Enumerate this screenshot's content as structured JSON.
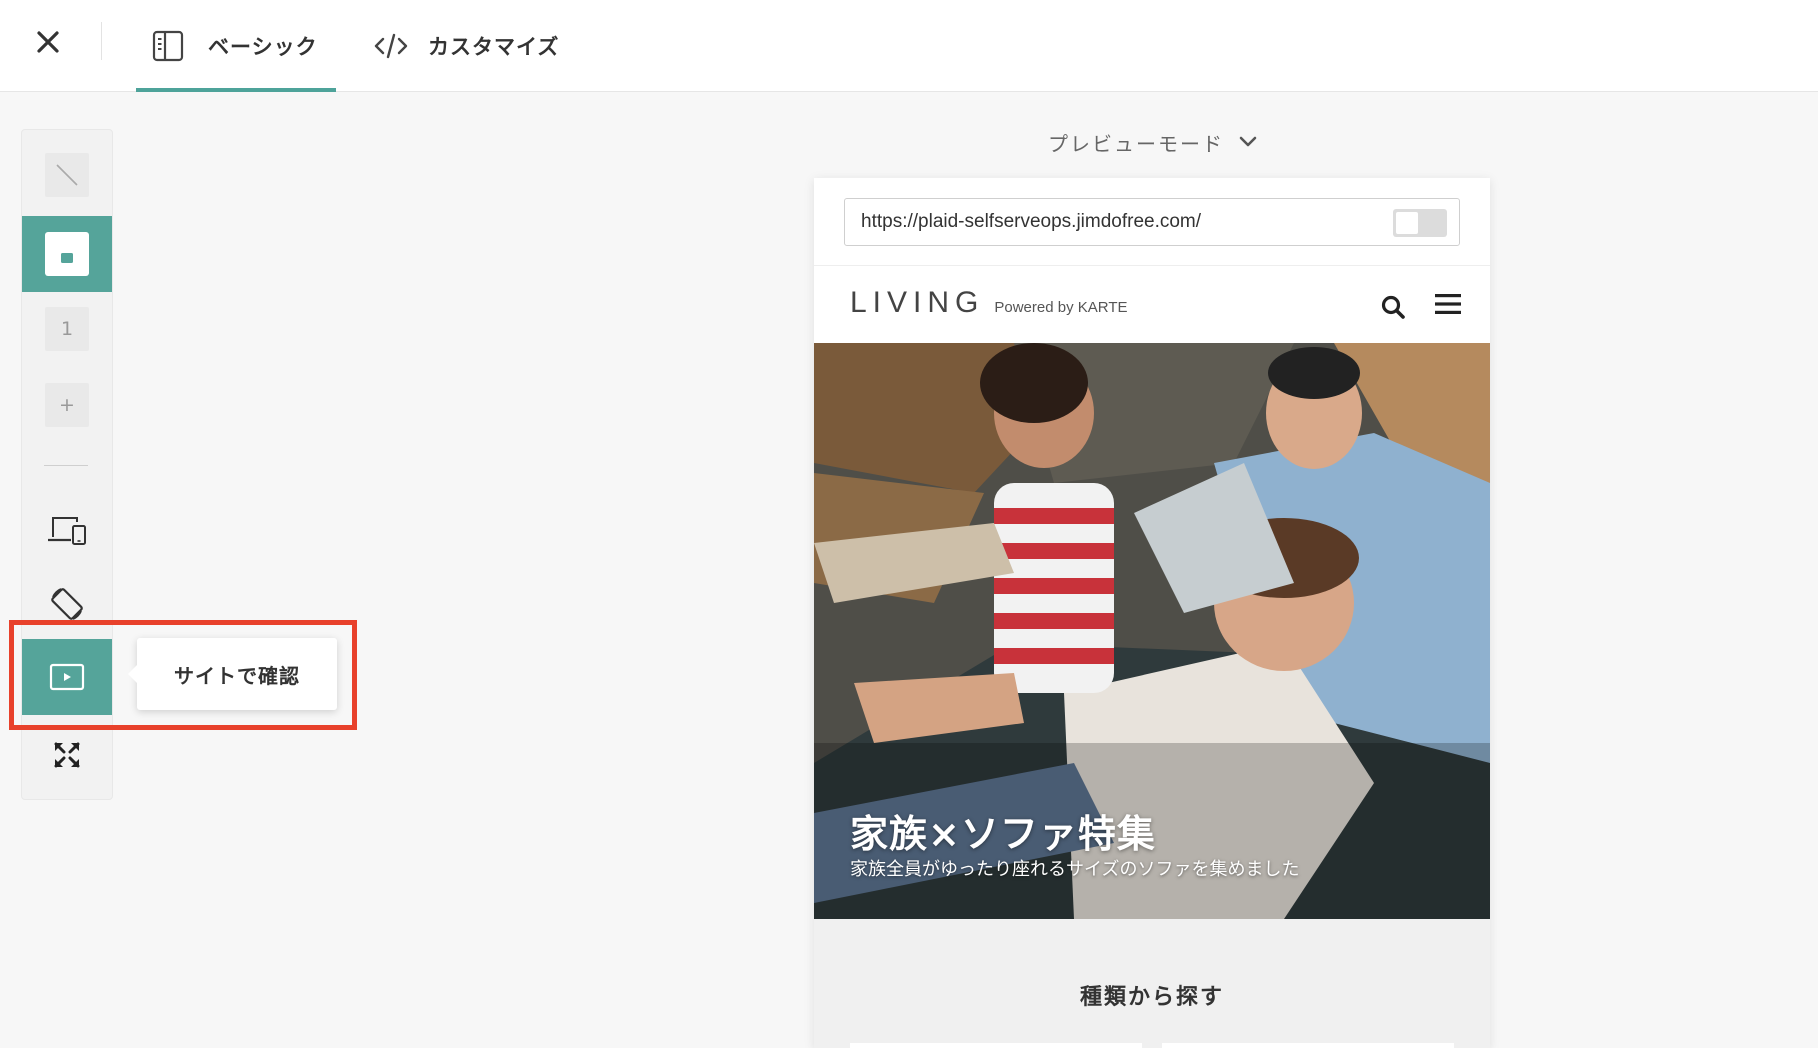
{
  "topbar": {
    "close_icon": "close-icon",
    "tabs": [
      {
        "label": "ベーシック",
        "icon": "panel-icon",
        "active": true
      },
      {
        "label": "カスタマイズ",
        "icon": "code-icon",
        "active": false
      }
    ],
    "accent_color": "#4ea39a"
  },
  "rail": {
    "items": [
      {
        "name": "slash-icon",
        "active": false
      },
      {
        "name": "frame-icon",
        "active": true
      },
      {
        "name": "page-number",
        "label": "1",
        "active": false
      },
      {
        "name": "plus-icon",
        "label": "+",
        "active": false
      },
      {
        "name": "devices-icon",
        "active": false
      },
      {
        "name": "rotate-icon",
        "active": false
      },
      {
        "name": "play-icon",
        "active": true
      },
      {
        "name": "expand-icon",
        "active": false
      }
    ],
    "tooltip": "サイトで確認",
    "highlight_color": "#e8412b"
  },
  "preview": {
    "mode_label": "プレビューモード",
    "url": "https://plaid-selfserveops.jimdofree.com/",
    "site": {
      "logo": "LIVING",
      "logo_sub": "Powered by KARTE",
      "hero_title": "家族×ソファ特集",
      "hero_subtitle": "家族全員がゆったり座れるサイズのソファを集めました",
      "section_title": "種類から探す"
    }
  }
}
